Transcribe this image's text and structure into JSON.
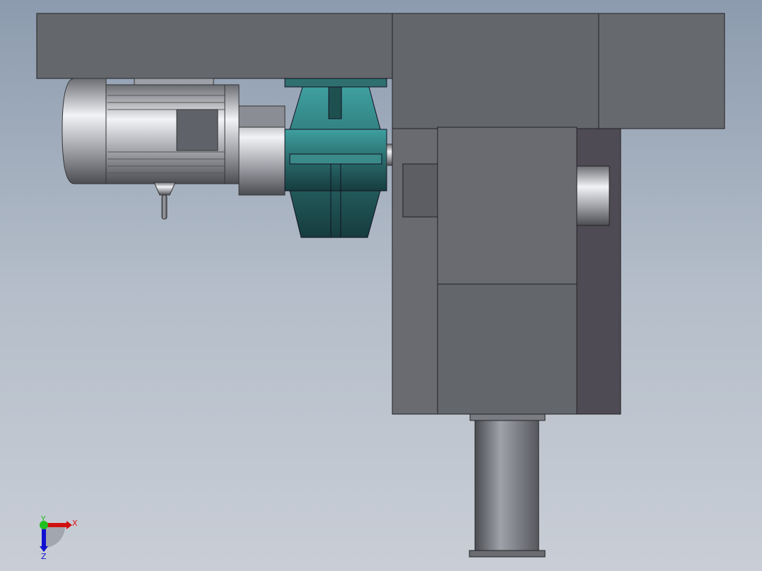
{
  "viewport": {
    "triad": {
      "x_label": "X",
      "y_label": "Y",
      "z_label": "Z"
    },
    "colors": {
      "x_axis": "#e01010",
      "y_axis": "#20c020",
      "z_axis": "#1010d0",
      "housing": "#63666b",
      "coupling": "#2a6b6b"
    }
  }
}
